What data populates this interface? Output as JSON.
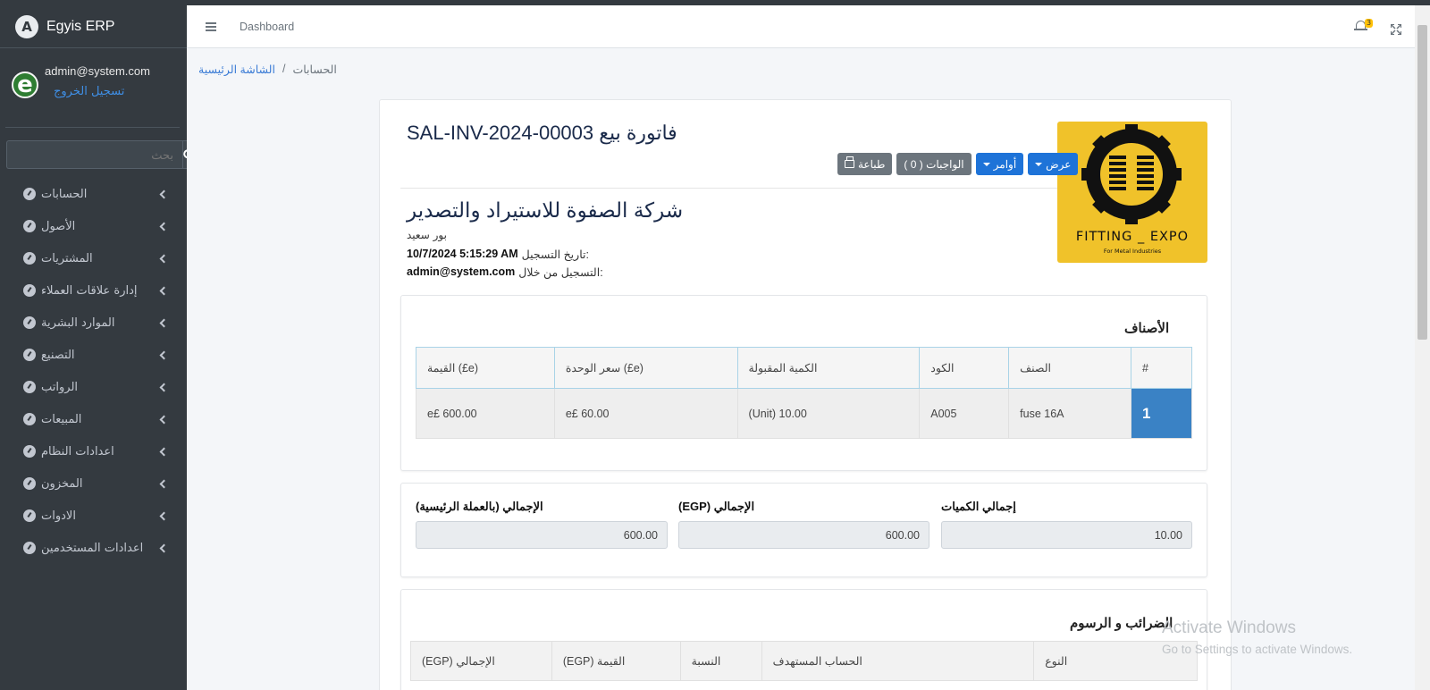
{
  "app": {
    "name": "Egyis ERP",
    "logo_letter": "A"
  },
  "user": {
    "email": "admin@system.com",
    "avatar_letter": "e",
    "logout": "تسجيل الخروج"
  },
  "sidebar": {
    "search_placeholder": "بحث",
    "items": [
      {
        "label": "الحسابات"
      },
      {
        "label": "الأصول"
      },
      {
        "label": "المشتريات"
      },
      {
        "label": "إدارة علاقات العملاء"
      },
      {
        "label": "الموارد البشرية"
      },
      {
        "label": "التصنيع"
      },
      {
        "label": "الرواتب"
      },
      {
        "label": "المبيعات"
      },
      {
        "label": "اعدادات النظام"
      },
      {
        "label": "المخزون"
      },
      {
        "label": "الادوات"
      },
      {
        "label": "اعدادات المستخدمين"
      }
    ]
  },
  "topbar": {
    "dashboard_link": "Dashboard",
    "notification_count": "3"
  },
  "breadcrumb": {
    "home": "الشاشة الرئيسية",
    "separator": "/",
    "current": "الحسابات"
  },
  "invoice": {
    "title": "فاتورة بيع SAL-INV-2024-00003",
    "company": "شركة الصفوة للاستيراد والتصدير",
    "city": "بور سعيد",
    "registered_label": "تاريخ التسجيل:",
    "registered_value": "10/7/2024 5:15:29 AM",
    "registered_by_label": "التسجيل من خلال:",
    "registered_by_value": "admin@system.com"
  },
  "logo": {
    "title": "FITTING _ EXPO",
    "subtitle": "For Metal Industries"
  },
  "actions": {
    "view": "عرض",
    "orders": "أوامر",
    "duties": "الواجبات ( 0 )",
    "print": "طباعة"
  },
  "items_section": {
    "title": "الأصناف",
    "headers": [
      "#",
      "الصنف",
      "الكود",
      "الكمية المقبولة",
      "سعر الوحدة (£e)",
      "القيمة (£e)"
    ],
    "rows": [
      {
        "num": "1",
        "item": "fuse 16A",
        "code": "A005",
        "qty": "(Unit) 10.00",
        "unit_price": "e£ 60.00",
        "value": "e£ 600.00"
      }
    ]
  },
  "totals": {
    "qty_label": "إجمالي الكميات",
    "qty_value": "10.00",
    "total_label": "(EGP) الإجمالي",
    "total_value": "600.00",
    "main_label": "الإجمالي (بالعملة الرئيسية)",
    "main_value": "600.00"
  },
  "taxes_section": {
    "title": "الضرائب و الرسوم",
    "headers": [
      "النوع",
      "الحساب المستهدف",
      "النسبة",
      "(EGP) القيمة",
      "(EGP) الإجمالي"
    ]
  },
  "watermark": {
    "line1": "Activate Windows",
    "line2": "Go to Settings to activate Windows."
  },
  "colors": {
    "sidebar_bg": "#343a40",
    "primary": "#1e73d8",
    "row_highlight": "#3a82c5",
    "logo_bg": "#f0c22a"
  }
}
